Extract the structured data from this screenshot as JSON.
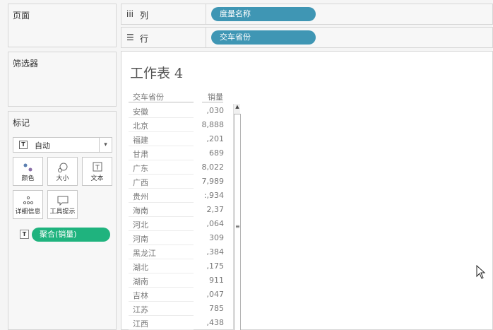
{
  "pages": {
    "title": "页面"
  },
  "filters": {
    "title": "筛选器"
  },
  "marks": {
    "title": "标记",
    "mark_type": "自动",
    "buttons": [
      {
        "label": "颜色",
        "icon": "color-dots-icon"
      },
      {
        "label": "大小",
        "icon": "size-icon"
      },
      {
        "label": "文本",
        "icon": "text-icon"
      },
      {
        "label": "详细信息",
        "icon": "detail-icon"
      },
      {
        "label": "工具提示",
        "icon": "tooltip-icon"
      }
    ],
    "pill": "聚合(销量)"
  },
  "shelves": {
    "columns": {
      "icon": "iii",
      "label": "列",
      "pill": "度量名称"
    },
    "rows": {
      "icon": "☰",
      "label": "行",
      "pill": "交车省份"
    }
  },
  "sheet": {
    "title": "工作表 4",
    "col1": "交车省份",
    "col2": "销量",
    "rows": [
      {
        "prov": "安徽",
        "val": ",030"
      },
      {
        "prov": "北京",
        "val": "8,888"
      },
      {
        "prov": "福建",
        "val": ",201"
      },
      {
        "prov": "甘肃",
        "val": "689"
      },
      {
        "prov": "广东",
        "val": "8,022"
      },
      {
        "prov": "广西",
        "val": "7,989"
      },
      {
        "prov": "贵州",
        "val": ":,934"
      },
      {
        "prov": "海南",
        "val": "2,37"
      },
      {
        "prov": "河北",
        "val": ",064"
      },
      {
        "prov": "河南",
        "val": "309"
      },
      {
        "prov": "黑龙江",
        "val": ",384"
      },
      {
        "prov": "湖北",
        "val": ",175"
      },
      {
        "prov": "湖南",
        "val": "911"
      },
      {
        "prov": "吉林",
        "val": ",047"
      },
      {
        "prov": "江苏",
        "val": "785"
      },
      {
        "prov": "江西",
        "val": ",438"
      }
    ]
  },
  "colors": {
    "blue_pill": "#3f96b4",
    "green_pill": "#1fb37e"
  }
}
